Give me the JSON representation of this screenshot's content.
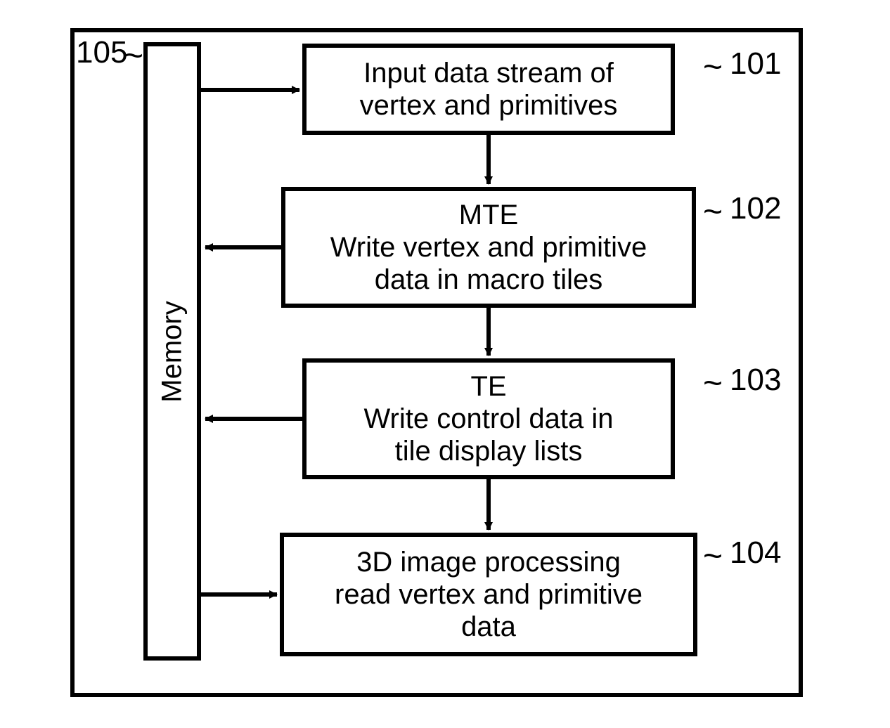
{
  "refs": {
    "memory": "105",
    "b1": "101",
    "b2": "102",
    "b3": "103",
    "b4": "104"
  },
  "memory_label": "Memory",
  "boxes": {
    "b1": {
      "l1": "Input data stream of",
      "l2": "vertex and primitives"
    },
    "b2": {
      "l1": "MTE",
      "l2": "Write vertex and primitive",
      "l3": "data in macro tiles"
    },
    "b3": {
      "l1": "TE",
      "l2": "Write control data in",
      "l3": "tile display lists"
    },
    "b4": {
      "l1": "3D image processing",
      "l2": "read vertex and primitive",
      "l3": "data"
    }
  }
}
